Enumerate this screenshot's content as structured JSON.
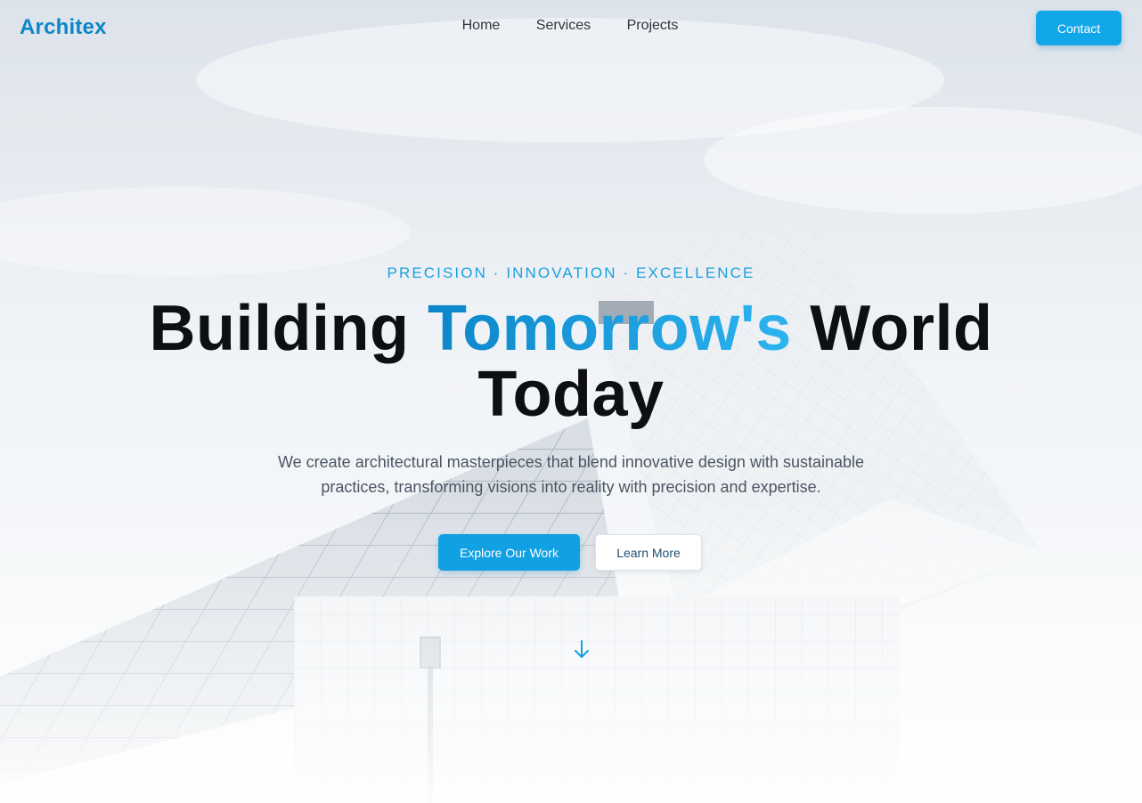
{
  "nav": {
    "logo": "Architex",
    "links": [
      "Home",
      "Services",
      "Projects"
    ],
    "contact_label": "Contact"
  },
  "hero": {
    "tagline": "PRECISION · INNOVATION · EXCELLENCE",
    "headline_part1": "Building ",
    "headline_highlight": "Tomorrow's",
    "headline_part2": " World",
    "headline_line2": "Today",
    "subtitle_line1": "We create architectural masterpieces that blend innovative design with sustainable",
    "subtitle_line2": "practices, transforming visions into reality with precision and expertise.",
    "primary_button": "Explore Our Work",
    "secondary_button": "Learn More",
    "scroll_icon": "arrow-down-icon"
  },
  "colors": {
    "accent": "#11a6e8",
    "logo": "#0b87c9",
    "heading": "#0d0f12",
    "body_text": "#4b5563"
  }
}
